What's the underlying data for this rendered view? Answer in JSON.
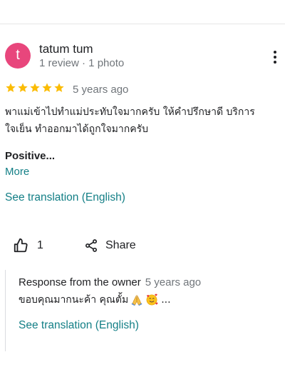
{
  "review": {
    "avatar_letter": "t",
    "avatar_color": "#e8467c",
    "author": "tatum tum",
    "meta": "1 review · 1 photo",
    "rating": 5,
    "date": "5 years ago",
    "text_line1": "พาแม่เข้าไปทำแม่ประทับใจมากครับ ให้คำปรึกษาดี บริการ",
    "text_line2": "ใจเย็น ทำออกมาได้ถูกใจมากครับ",
    "positive_label": "Positive...",
    "more_label": "More",
    "see_translation": "See translation (English)",
    "like_count": "1",
    "share_label": "Share"
  },
  "owner_response": {
    "title": "Response from the owner",
    "date": "5 years ago",
    "text": "ขอบคุณมากนะค้า คุณตั้ม",
    "text_suffix": "...",
    "emojis": [
      "folded-hands-icon",
      "smiling-face-with-hearts-icon"
    ],
    "see_translation": "See translation (English)"
  },
  "colors": {
    "star": "#fbbc04",
    "link": "#137f86",
    "muted": "#70757a"
  }
}
